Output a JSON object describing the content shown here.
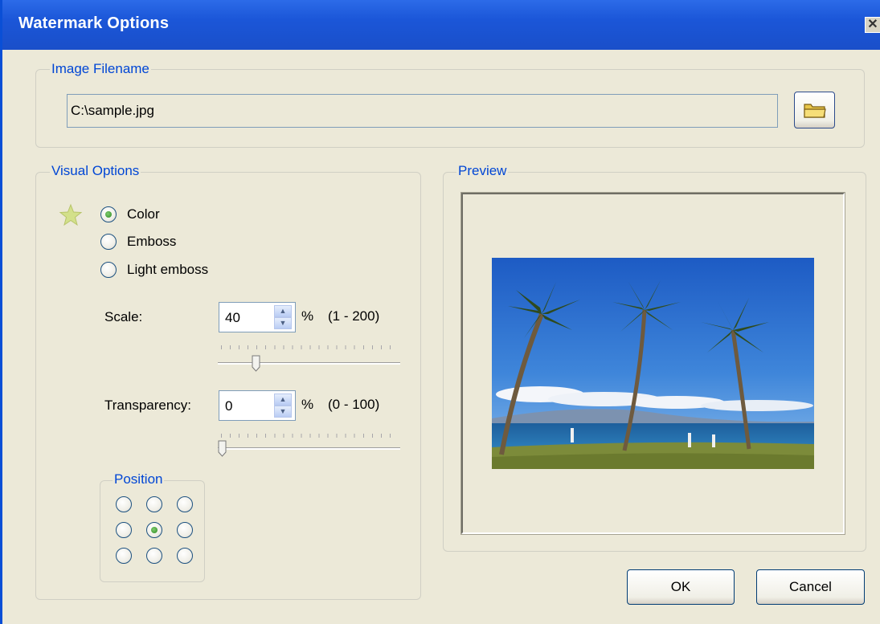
{
  "window": {
    "title": "Watermark Options",
    "close_glyph": "✕"
  },
  "image_filename": {
    "legend": "Image Filename",
    "value": "C:\\sample.jpg",
    "browse_icon": "folder-icon"
  },
  "visual_options": {
    "legend": "Visual Options",
    "style_icon": "star-icon",
    "radios": [
      {
        "label": "Color",
        "checked": true
      },
      {
        "label": "Emboss",
        "checked": false
      },
      {
        "label": "Light emboss",
        "checked": false
      }
    ],
    "scale": {
      "label": "Scale:",
      "value": "40",
      "unit": "%",
      "range": "(1 - 200)",
      "min": 1,
      "max": 200
    },
    "transparency": {
      "label": "Transparency:",
      "value": "0",
      "unit": "%",
      "range": "(0 - 100)",
      "min": 0,
      "max": 100
    },
    "position": {
      "legend": "Position",
      "selected_row": 1,
      "selected_col": 1
    }
  },
  "preview": {
    "legend": "Preview",
    "image": "beach-palm-trees-photo"
  },
  "buttons": {
    "ok": "OK",
    "cancel": "Cancel"
  },
  "colors": {
    "titlebar": "#1B56D8",
    "legend_text": "#0046D5",
    "dialog_bg": "#ECE9D8"
  }
}
